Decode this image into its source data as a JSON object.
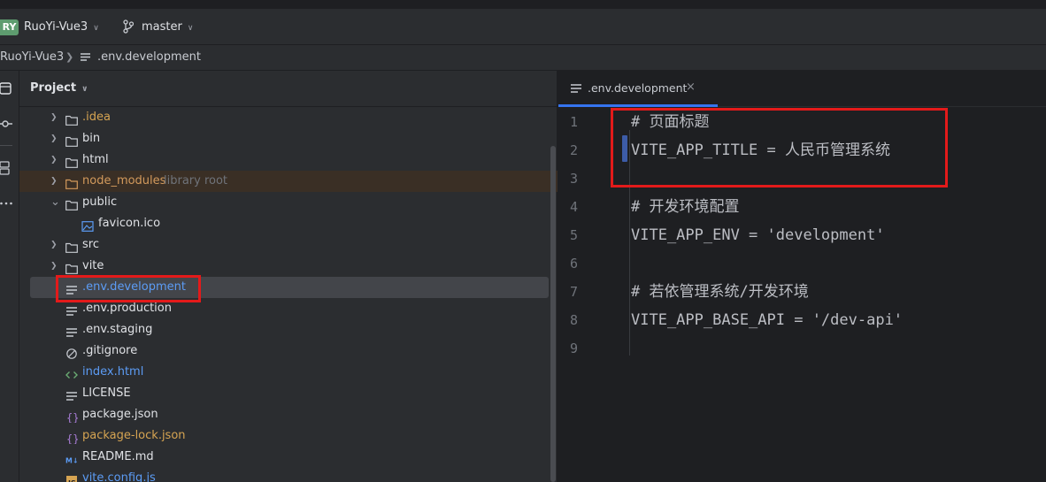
{
  "titlebar": {
    "project_badge": "RY",
    "project_name": "RuoYi-Vue3",
    "branch_name": "master"
  },
  "breadcrumb": {
    "root": "RuoYi-Vue3",
    "file": ".env.development"
  },
  "project_panel": {
    "title": "Project",
    "items": [
      {
        "label": ".idea",
        "type": "folder",
        "color": "#d6a452"
      },
      {
        "label": "bin",
        "type": "folder"
      },
      {
        "label": "html",
        "type": "folder"
      },
      {
        "label": "node_modules",
        "type": "folder",
        "note": "library root",
        "color": "#d39a5c"
      },
      {
        "label": "public",
        "type": "folder"
      },
      {
        "label": "favicon.ico",
        "type": "image"
      },
      {
        "label": "src",
        "type": "folder"
      },
      {
        "label": "vite",
        "type": "folder"
      },
      {
        "label": ".env.development",
        "type": "text",
        "color": "#5c9cf5"
      },
      {
        "label": ".env.production",
        "type": "text"
      },
      {
        "label": ".env.staging",
        "type": "text"
      },
      {
        "label": ".gitignore",
        "type": "ignore"
      },
      {
        "label": "index.html",
        "type": "html",
        "color": "#5c9cf5"
      },
      {
        "label": "LICENSE",
        "type": "text"
      },
      {
        "label": "package.json",
        "type": "json"
      },
      {
        "label": "package-lock.json",
        "type": "json",
        "color": "#d6a452"
      },
      {
        "label": "README.md",
        "type": "markdown"
      },
      {
        "label": "vite.config.js",
        "type": "js",
        "color": "#5c9cf5"
      }
    ]
  },
  "editor": {
    "tab_label": ".env.development",
    "tab_close": "×",
    "line_numbers": [
      "1",
      "2",
      "3",
      "4",
      "5",
      "6",
      "7",
      "8",
      "9"
    ],
    "lines": [
      "# 页面标题",
      "VITE_APP_TITLE = 人民币管理系统",
      "",
      "# 开发环境配置",
      "VITE_APP_ENV = 'development'",
      "",
      "# 若依管理系统/开发环境",
      "VITE_APP_BASE_API = '/dev-api'",
      ""
    ]
  },
  "colors": {
    "accent": "#3574f0",
    "annotation_red": "#e31a1a"
  }
}
